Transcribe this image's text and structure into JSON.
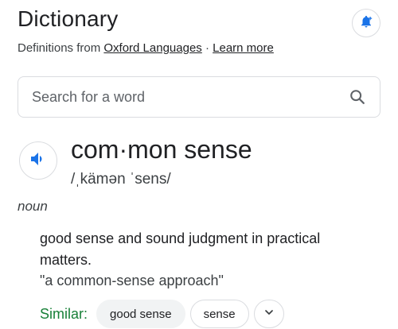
{
  "header": {
    "title": "Dictionary",
    "subtitle_prefix": "Definitions from ",
    "source_link": "Oxford Languages",
    "separator": " · ",
    "learn_more_link": "Learn more",
    "bell_icon": "bell-plus-icon"
  },
  "search": {
    "placeholder": "Search for a word",
    "value": "",
    "icon": "search-icon"
  },
  "entry": {
    "speaker_icon": "speaker-icon",
    "headword": "com·mon sense",
    "phonetic": "/ˌkämən ˈsens/",
    "part_of_speech": "noun",
    "definition": "good sense and sound judgment in practical matters.",
    "example": "\"a common-sense approach\"",
    "similar_label": "Similar:",
    "similar": [
      "good sense",
      "sense"
    ],
    "expand_icon": "chevron-down-icon"
  },
  "colors": {
    "accent_blue": "#1a73e8",
    "similar_green": "#188038",
    "border": "#dadce0",
    "chip_fill": "#f1f3f4"
  }
}
